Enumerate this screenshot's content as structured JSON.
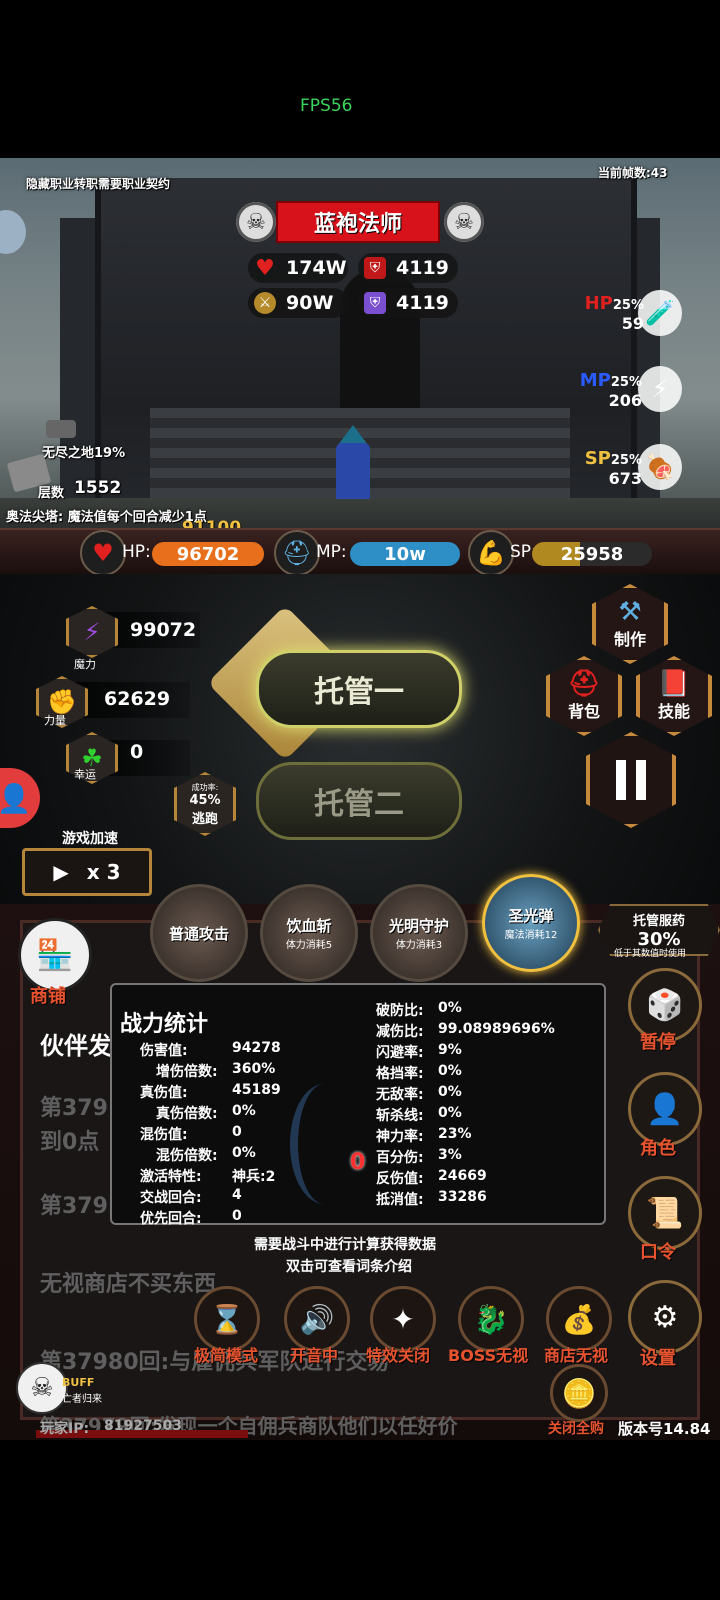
{
  "fps": "FPS56",
  "scene": {
    "notice": "隐藏职业转职需要职业契约",
    "frame_counter": "当前帧数:43",
    "boss": {
      "name": "蓝袍法师",
      "hp": "174W",
      "defense": "4119",
      "attack": "90W",
      "magic_defense": "4119"
    },
    "bottles": [
      {
        "label": "HP",
        "pct": "25%",
        "value": "59",
        "color": "#e0211f"
      },
      {
        "label": "MP",
        "pct": "25%",
        "value": "206",
        "color": "#2a5bff"
      },
      {
        "label": "SP",
        "pct": "25%",
        "value": "673",
        "color": "#f0c040"
      }
    ],
    "zone": "无尽之地19%",
    "floor_label": "层数",
    "floor_value": "1552",
    "tower_effect": "奥法尖塔:  魔法值每个回合减少1点",
    "floating_damage": "91100"
  },
  "status": {
    "hp_label": "HP:",
    "hp_value": "96702",
    "mp_label": "MP:",
    "mp_value": "10w",
    "sp_label": "SP:",
    "sp_value": "25958"
  },
  "attributes": [
    {
      "value": "99072",
      "label": "魔力",
      "icon": "lightning-icon"
    },
    {
      "value": "62629",
      "label": "力量",
      "icon": "fist-icon"
    },
    {
      "value": "0",
      "label": "幸运",
      "icon": "clover-icon"
    }
  ],
  "auto": {
    "one": "托管一",
    "two": "托管二"
  },
  "escape": {
    "rate_label": "成功率:",
    "rate": "45%",
    "label": "逃跑"
  },
  "speed": {
    "title": "游戏加速",
    "value": "x 3"
  },
  "menu": {
    "craft": "制作",
    "bag": "背包",
    "skills": "技能"
  },
  "skills": [
    {
      "name": "普通攻击",
      "cost": ""
    },
    {
      "name": "饮血斩",
      "cost": "体力消耗5"
    },
    {
      "name": "光明守护",
      "cost": "体力消耗3"
    },
    {
      "name": "圣光弹",
      "cost": "魔法消耗12"
    }
  ],
  "auto_potion": {
    "title": "托管服药",
    "value": "30%",
    "note": "低于其数值时使用"
  },
  "shop": "商铺",
  "partner_title": "伙伴发",
  "logs": [
    "第379",
    "到0点",
    "第379",
    "无视商店不买东西",
    "第37980回:与雇佣兵军队进行交易",
    "第37979回:发现一个自佣兵商队他们以任好价"
  ],
  "right_menu": {
    "pause": "暂停",
    "role": "角色",
    "command": "口令",
    "settings": "设置"
  },
  "stats_panel": {
    "title": "战力统计",
    "left": [
      {
        "k": "伤害值:",
        "v": "94278",
        "indent": false
      },
      {
        "k": "增伤倍数:",
        "v": "360%",
        "indent": true
      },
      {
        "k": "真伤值:",
        "v": "45189",
        "indent": false
      },
      {
        "k": "真伤倍数:",
        "v": "0%",
        "indent": true
      },
      {
        "k": "混伤值:",
        "v": "0",
        "indent": false
      },
      {
        "k": "混伤倍数:",
        "v": "0%",
        "indent": true
      },
      {
        "k": "激活特性:",
        "v": "神兵:2",
        "indent": false
      },
      {
        "k": "交战回合:",
        "v": "4",
        "indent": false
      },
      {
        "k": "优先回合:",
        "v": "0",
        "indent": false
      }
    ],
    "right": [
      {
        "k": "破防比:",
        "v": "0%"
      },
      {
        "k": "减伤比:",
        "v": "99.08989696%"
      },
      {
        "k": "闪避率:",
        "v": "9%"
      },
      {
        "k": "格挡率:",
        "v": "0%"
      },
      {
        "k": "无敌率:",
        "v": "0%"
      },
      {
        "k": "斩杀线:",
        "v": "0%"
      },
      {
        "k": "神力率:",
        "v": "23%"
      },
      {
        "k": "百分伤:",
        "v": "3%"
      },
      {
        "k": "反伤值:",
        "v": "24669"
      },
      {
        "k": "抵消值:",
        "v": "33286"
      }
    ],
    "center_value": "0",
    "hint1": "需要战斗中进行计算获得数据",
    "hint2": "双击可查看词条介绍"
  },
  "bottom_buttons": [
    {
      "label": "极简模式",
      "icon": "hourglass-icon"
    },
    {
      "label": "开音中",
      "icon": "speaker-icon"
    },
    {
      "label": "特效关闭",
      "icon": "effect-icon"
    },
    {
      "label": "BOSS无视",
      "icon": "dragon-icon"
    },
    {
      "label": "商店无视",
      "icon": "bag-icon"
    }
  ],
  "close_buy": "关闭全购",
  "buff": {
    "label": "BUFF",
    "note": "亡者归来"
  },
  "player_ip_label": "玩家IP:",
  "player_ip": "81927503",
  "version": "版本号14.84"
}
